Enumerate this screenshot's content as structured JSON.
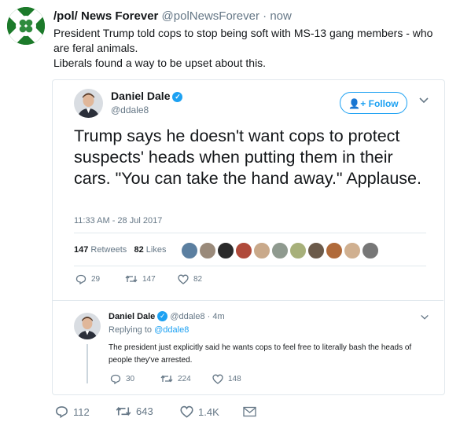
{
  "tweet": {
    "author_name": "/pol/ News Forever",
    "author_handle": "@polNewsForever",
    "separator": "·",
    "time": "now",
    "text_line1": "President Trump told cops to stop being soft with MS-13 gang members - who are feral animals.",
    "text_line2": "Liberals found a way to be upset about this.",
    "reply_count": "112",
    "retweet_count": "643",
    "like_count": "1.4K"
  },
  "quoted": {
    "author_name": "Daniel Dale",
    "author_handle": "@ddale8",
    "follow_label": "Follow",
    "text": "Trump says he doesn't want cops to protect suspects' heads when putting them in their cars. \"You can take the hand away.\" Applause.",
    "timestamp": "11:33 AM - 28 Jul 2017",
    "retweets_num": "147",
    "retweets_label": "Retweets",
    "likes_num": "82",
    "likes_label": "Likes",
    "reply_count": "29",
    "retweet_count": "147",
    "like_count": "82"
  },
  "reply": {
    "author_name": "Daniel Dale",
    "author_handle": "@ddale8",
    "separator": "·",
    "time": "4m",
    "replying_prefix": "Replying to",
    "replying_to": "@ddale8",
    "text": "The president just explicitly said he wants cops to feel free to literally bash the heads of people they've arrested.",
    "reply_count": "30",
    "retweet_count": "224",
    "like_count": "148"
  },
  "colors": {
    "accent": "#1da1f2",
    "muted": "#657786",
    "border": "#e1e8ed"
  }
}
